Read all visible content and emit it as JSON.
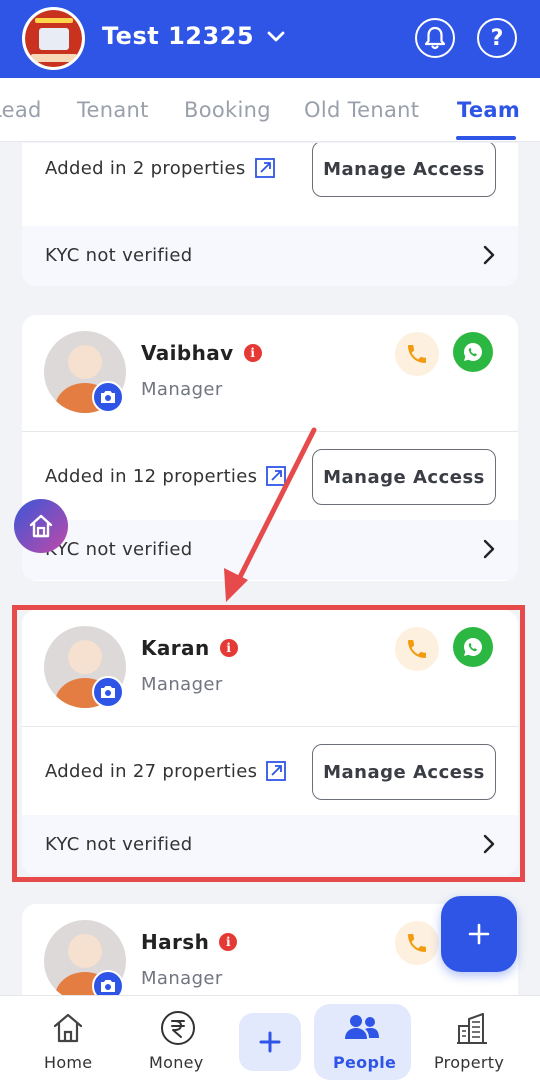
{
  "header": {
    "title": "Test 12325",
    "logo_icon": "brand-logo",
    "bell_icon": "bell-icon",
    "help_label": "?"
  },
  "tabs": [
    {
      "label": "Lead",
      "active": false
    },
    {
      "label": "Tenant",
      "active": false
    },
    {
      "label": "Booking",
      "active": false
    },
    {
      "label": "Old Tenant",
      "active": false
    },
    {
      "label": "Team",
      "active": true
    }
  ],
  "cards": [
    {
      "name": "",
      "role": "",
      "added_text": "Added in 2 properties",
      "manage_label": "Manage Access",
      "kyc_text": "KYC not verified"
    },
    {
      "name": "Vaibhav",
      "role": "Manager",
      "added_text": "Added in 12 properties",
      "manage_label": "Manage Access",
      "kyc_text": "KYC not verified"
    },
    {
      "name": "Karan",
      "role": "Manager",
      "added_text": "Added in 27 properties",
      "manage_label": "Manage Access",
      "kyc_text": "KYC not verified"
    },
    {
      "name": "Harsh",
      "role": "Manager"
    }
  ],
  "info_glyph": "i",
  "bottom_nav": [
    {
      "label": "Home",
      "icon": "home-icon"
    },
    {
      "label": "Money",
      "icon": "rupee-icon"
    },
    {
      "label": "People",
      "icon": "people-icon",
      "active": true
    },
    {
      "label": "Property",
      "icon": "building-icon"
    }
  ],
  "colors": {
    "primary": "#2f55e6",
    "highlight": "#e64a4a",
    "whatsapp": "#2bb741",
    "call": "#f39c12"
  }
}
